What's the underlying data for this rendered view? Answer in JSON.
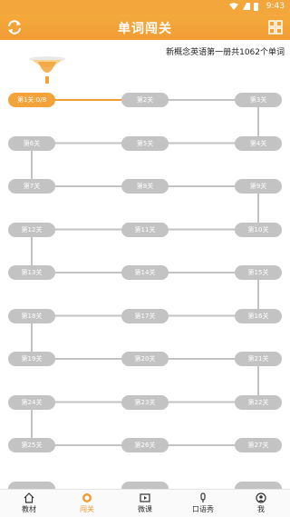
{
  "status_bar": {
    "time": "9:43"
  },
  "header": {
    "title": "单词闯关"
  },
  "subtitle": "新概念英语第一册共1062个单词",
  "levels": [
    {
      "label": "第1关:0/8",
      "active": true
    },
    {
      "label": "第2关"
    },
    {
      "label": "第3关"
    },
    {
      "label": "第4关"
    },
    {
      "label": "第5关"
    },
    {
      "label": "第6关"
    },
    {
      "label": "第7关"
    },
    {
      "label": "第8关"
    },
    {
      "label": "第9关"
    },
    {
      "label": "第10关"
    },
    {
      "label": "第11关"
    },
    {
      "label": "第12关"
    },
    {
      "label": "第13关"
    },
    {
      "label": "第14关"
    },
    {
      "label": "第15关"
    },
    {
      "label": "第16关"
    },
    {
      "label": "第17关"
    },
    {
      "label": "第18关"
    },
    {
      "label": "第19关"
    },
    {
      "label": "第20关"
    },
    {
      "label": "第21关"
    },
    {
      "label": "第22关"
    },
    {
      "label": "第23关"
    },
    {
      "label": "第24关"
    },
    {
      "label": "第25关"
    },
    {
      "label": "第26关"
    },
    {
      "label": "第27关"
    }
  ],
  "colors": {
    "accent": "#f19c34",
    "locked": "#c3c3c3",
    "path": "#c3c3c3"
  },
  "tabs": [
    {
      "label": "教材",
      "icon": "home-icon"
    },
    {
      "label": "闯关",
      "icon": "target-icon",
      "active": true
    },
    {
      "label": "微课",
      "icon": "video-icon"
    },
    {
      "label": "口语秀",
      "icon": "mic-icon"
    },
    {
      "label": "我",
      "icon": "user-icon"
    }
  ]
}
